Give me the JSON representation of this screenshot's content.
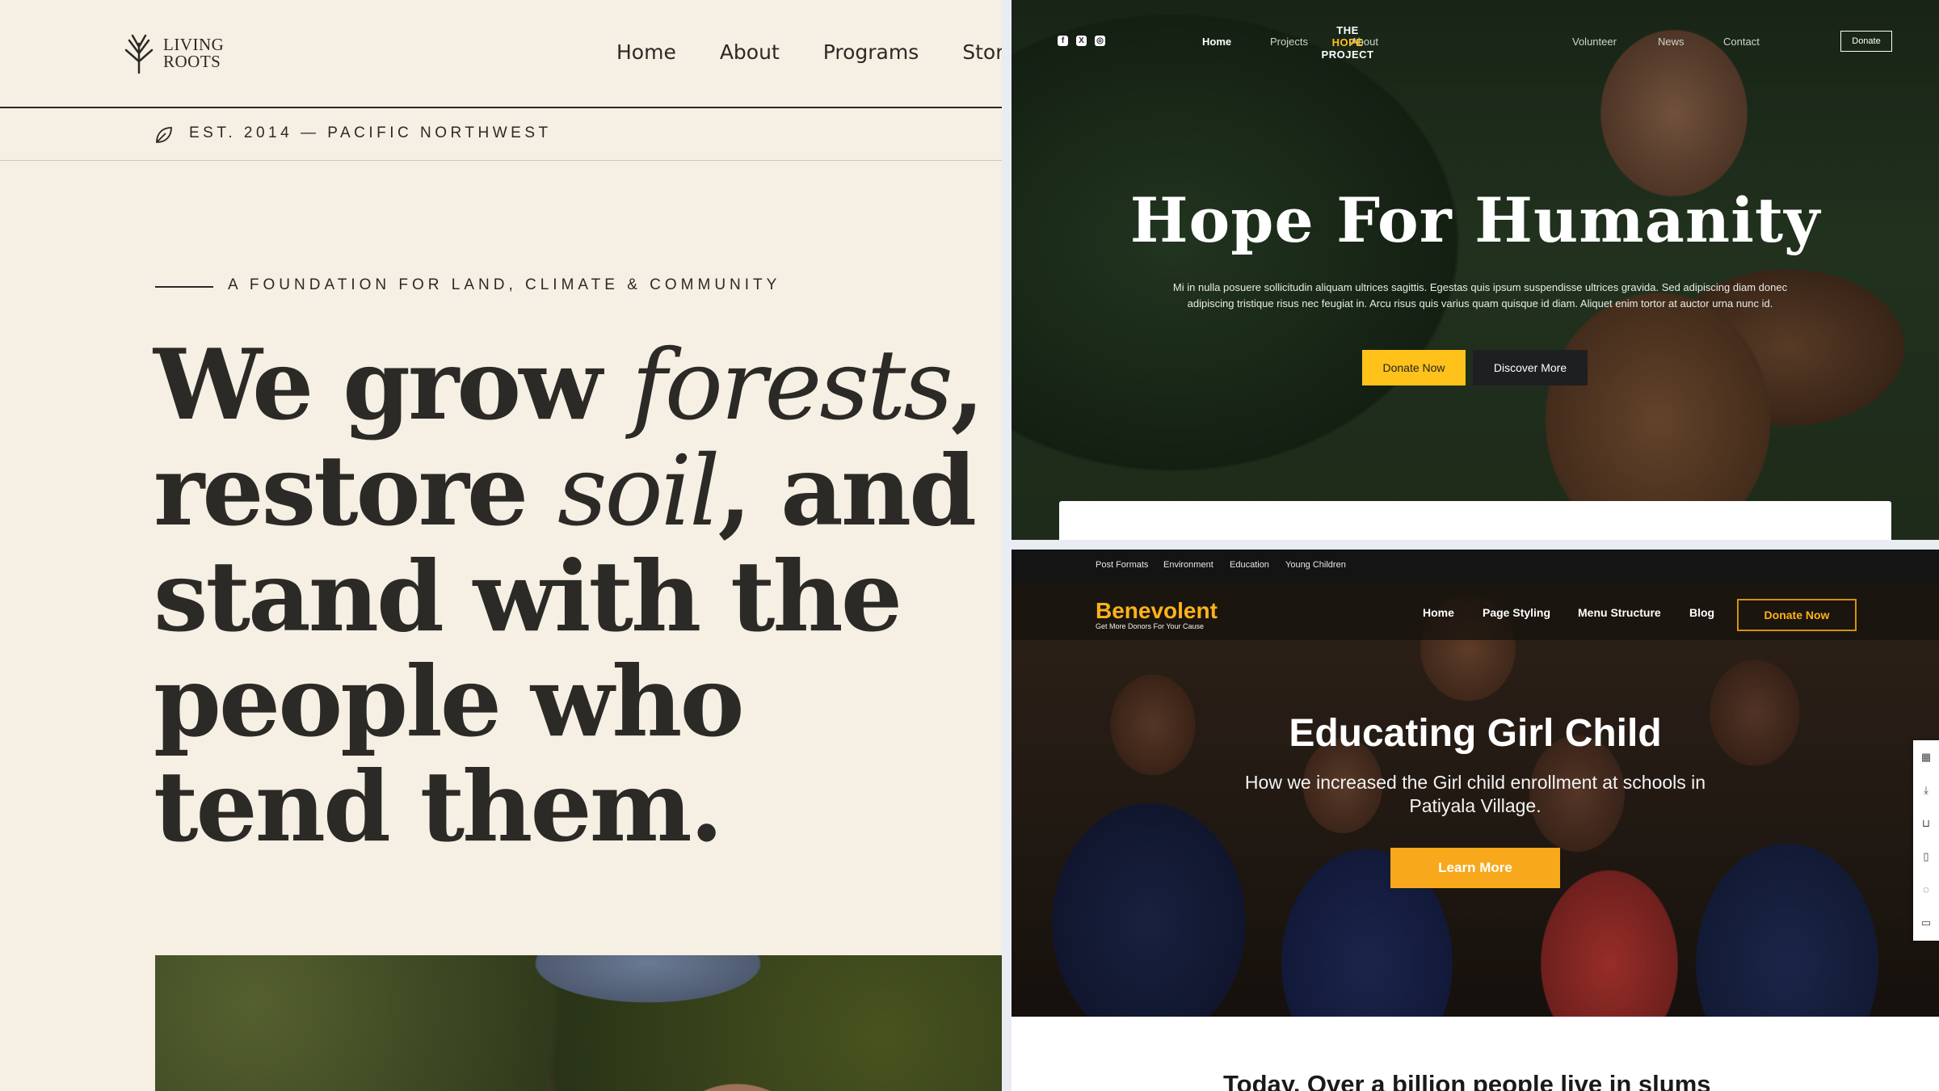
{
  "living_roots": {
    "logo": {
      "line1": "LIVING",
      "line2": "ROOTS",
      "icon": "tree-icon"
    },
    "nav": [
      "Home",
      "About",
      "Programs",
      "Storie"
    ],
    "est": {
      "icon": "leaf-icon",
      "text": "EST. 2014 — PACIFIC NORTHWEST"
    },
    "kicker": "A FOUNDATION FOR LAND, CLIMATE & COMMUNITY",
    "headline": {
      "p1": "We grow ",
      "i1": "forests",
      "p2": ", restore ",
      "i2": "soil",
      "p3": ", and stand with the people who tend them."
    },
    "colors": {
      "background": "#f6efe3",
      "text": "#2b2a26"
    }
  },
  "hope_project": {
    "social": [
      "facebook-icon",
      "x-icon",
      "instagram-icon"
    ],
    "nav": {
      "home": "Home",
      "projects": "Projects",
      "about": "About",
      "volunteer": "Volunteer",
      "news": "News",
      "contact": "Contact"
    },
    "brand": {
      "line1": "THE",
      "line2": "HOPE",
      "line3": "PROJECT"
    },
    "donate": "Donate",
    "title": "Hope For Humanity",
    "body": "Mi in nulla posuere sollicitudin aliquam ultrices sagittis. Egestas quis ipsum suspendisse ultrices gravida. Sed adipiscing diam donec adipiscing tristique risus nec feugiat in. Arcu risus quis varius quam quisque id diam. Aliquet enim tortor at auctor urna nunc id.",
    "buttons": {
      "primary": "Donate Now",
      "secondary": "Discover More"
    },
    "colors": {
      "accent": "#ffc21a",
      "dark_button": "#1e1f21"
    }
  },
  "benevolent": {
    "topbar": [
      "Post Formats",
      "Environment",
      "Education",
      "Young Children"
    ],
    "brand": {
      "name": "Benevolent",
      "tagline": "Get More Donors For Your Cause"
    },
    "nav": [
      "Home",
      "Page Styling",
      "Menu Structure",
      "Blog"
    ],
    "donate": "Donate Now",
    "hero": {
      "title": "Educating Girl Child",
      "subtitle": "How we increased the Girl child enrollment at schools in Patiyala Village.",
      "button": "Learn More"
    },
    "side_tools": [
      "grid-icon",
      "download-icon",
      "cart-icon",
      "document-icon",
      "chat-icon",
      "card-icon"
    ],
    "bottom_text": "Today, Over a billion people live in slums",
    "colors": {
      "accent": "#f7a81b"
    }
  }
}
